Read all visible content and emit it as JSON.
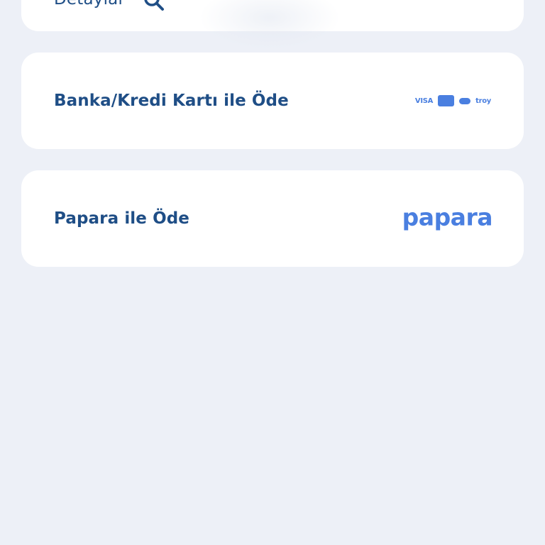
{
  "details": {
    "label": "Detaylar",
    "icon": "search-icon"
  },
  "payment_options": {
    "bank": {
      "label": "Banka/Kredi Kartı ile Öde",
      "logos": [
        "Visa",
        "Mastercard",
        "Maestro",
        "troy"
      ],
      "visa_text": "VISA",
      "troy_text": "troy"
    },
    "papara": {
      "label": "Papara ile Öde",
      "logo_text": "papara"
    }
  },
  "colors": {
    "background": "#edf0f7",
    "card": "#ffffff",
    "label_text": "#1f4e86",
    "logo_blue": "#4a7fe0"
  }
}
